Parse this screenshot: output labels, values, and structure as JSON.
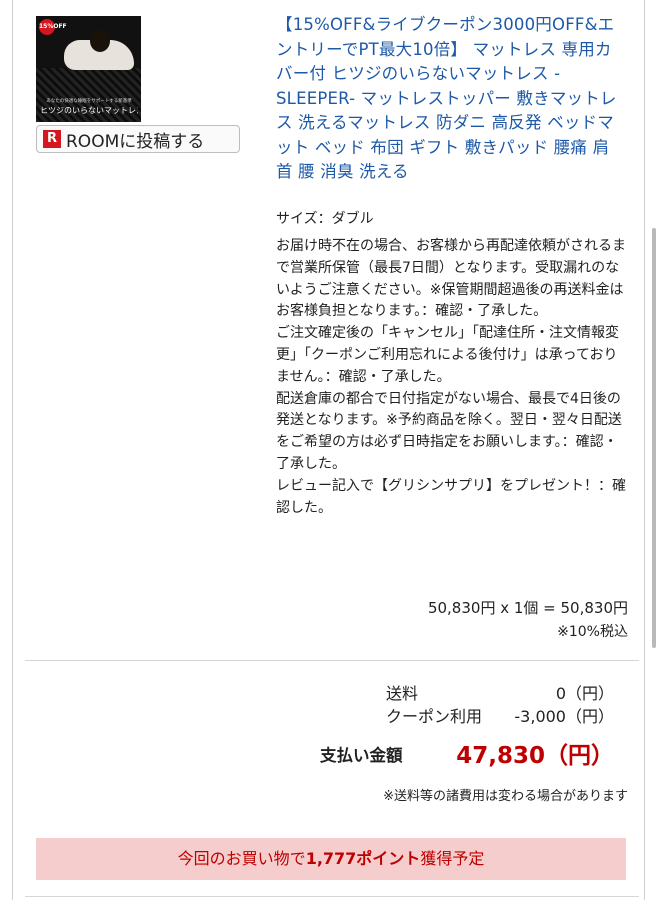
{
  "product": {
    "image": {
      "badge_text": "15%OFF",
      "caption_small": "あなたの快適な睡眠をサポートする新基準",
      "caption_large": "ヒツジのいらないマットレス"
    },
    "room_button_label": "ROOMに投稿する",
    "title": "【15%OFF&ライブクーポン3000円OFF&エントリーでPT最大10倍】 マットレス 専用カバー付 ヒツジのいらないマットレス -SLEEPER- マットレストッパー 敷きマットレス 洗えるマットレス 防ダニ 高反発 ベッドマット ベッド 布団 ギフト 敷きパッド 腰痛 肩 首 腰 消臭 洗える",
    "size_option": "サイズ：ダブル",
    "notes": [
      "お届け時不在の場合、お客様から再配達依頼がされるまで営業所保管（最長7日間）となります。受取漏れのないようご注意ください。※保管期間超過後の再送料金はお客様負担となります。：確認・了承した。",
      "ご注文確定後の「キャンセル」「配達住所・注文情報変更」「クーポンご利用忘れによる後付け」は承っておりません。：確認・了承した。",
      "配送倉庫の都合で日付指定がない場合、最長で4日後の発送となります。※予約商品を除く。翌日・翌々日配送をご希望の方は必ず日時指定をお願いします。：確認・了承した。",
      "レビュー記入で【グリシンサプリ】をプレゼント！：確認した。"
    ],
    "price_line": "50,830円 x 1個 = 50,830円",
    "tax_note": "※10%税込"
  },
  "summary": {
    "shipping_label": "送料",
    "shipping_value": "0（円）",
    "coupon_label": "クーポン利用",
    "coupon_value": "-3,000（円）",
    "total_label": "支払い金額",
    "total_value": "47,830（円）",
    "fee_note": "※送料等の諸費用は変わる場合があります"
  },
  "points": {
    "prefix": "今回のお買い物で",
    "points_text": "1,777ポイント",
    "suffix": "獲得予定"
  },
  "colors": {
    "link": "#1d59a8",
    "total": "#bf0000",
    "points_bg": "#f6cdcd",
    "rakuten_red": "#d4161f"
  }
}
